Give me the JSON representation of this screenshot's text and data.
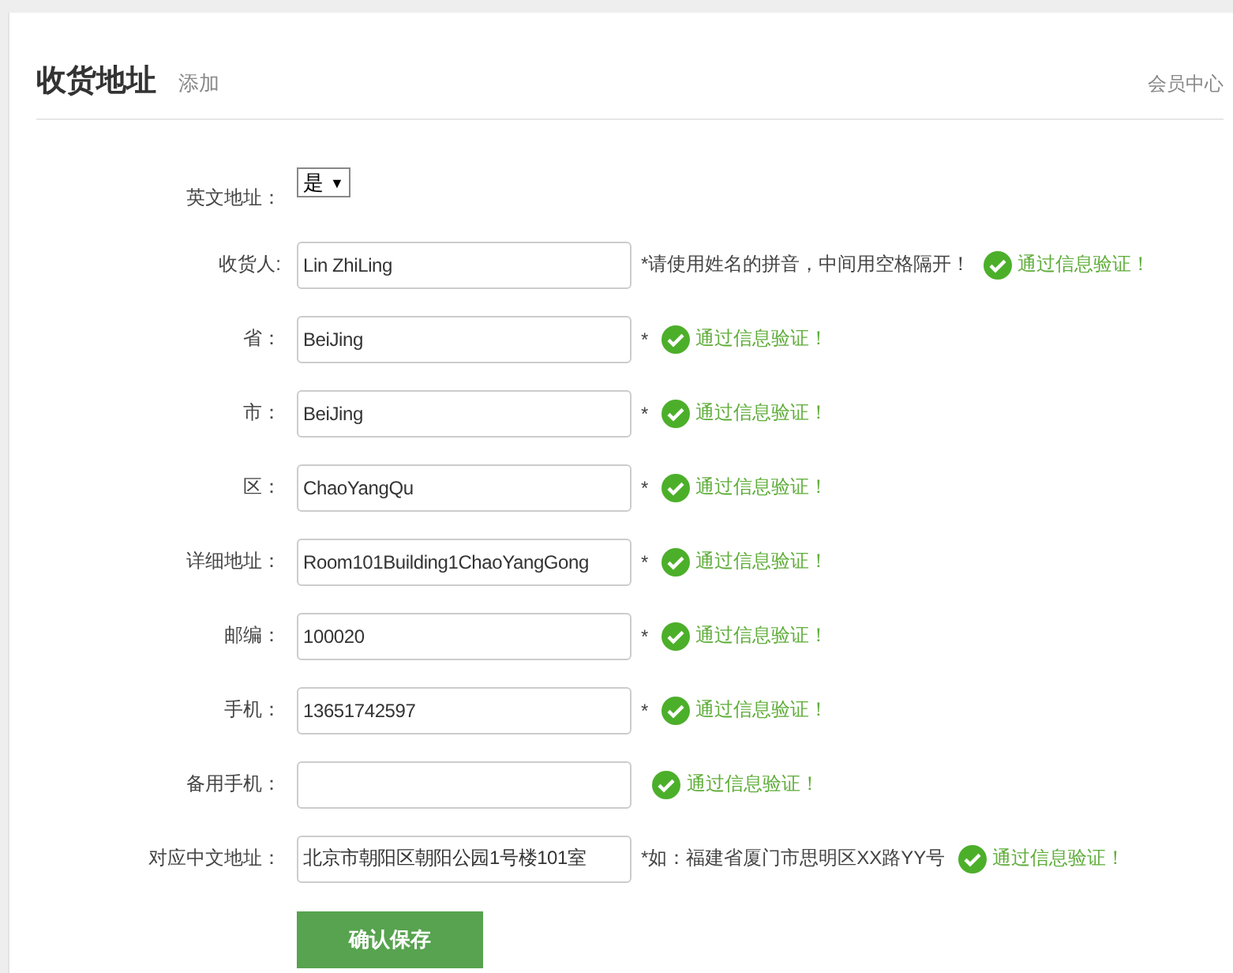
{
  "header": {
    "title": "收货地址",
    "subtitle": "添加",
    "link": "会员中心"
  },
  "fields": [
    {
      "kind": "select",
      "label": "英文地址：",
      "value": "是",
      "caret": "▼"
    },
    {
      "kind": "text",
      "label": "收货人:",
      "value": "Lin ZhiLing",
      "note": "*请使用姓名的拼音，中间用空格隔开！",
      "validation": {
        "text": "通过信息验证！",
        "passed": true
      }
    },
    {
      "kind": "text",
      "label": "省：",
      "value": "BeiJing",
      "note": "*",
      "validation": {
        "text": "通过信息验证！",
        "passed": true
      }
    },
    {
      "kind": "text",
      "label": "市：",
      "value": "BeiJing",
      "note": "*",
      "validation": {
        "text": "通过信息验证！",
        "passed": true
      }
    },
    {
      "kind": "text",
      "label": "区：",
      "value": "ChaoYangQu",
      "note": "*",
      "validation": {
        "text": "通过信息验证！",
        "passed": true
      }
    },
    {
      "kind": "text",
      "label": "详细地址：",
      "value": "Room101Building1ChaoYangGong",
      "note": "*",
      "validation": {
        "text": "通过信息验证！",
        "passed": true
      }
    },
    {
      "kind": "text",
      "label": "邮编：",
      "value": "100020",
      "note": "*",
      "validation": {
        "text": "通过信息验证！",
        "passed": true
      }
    },
    {
      "kind": "text",
      "label": "手机：",
      "value": "13651742597",
      "note": "*",
      "validation": {
        "text": "通过信息验证！",
        "passed": true
      }
    },
    {
      "kind": "text",
      "label": "备用手机：",
      "validation": {
        "text": "通过信息验证！",
        "passed": true
      }
    },
    {
      "kind": "text",
      "label": "对应中文地址：",
      "value": "北京市朝阳区朝阳公园1号楼101室",
      "note": "*如：福建省厦门市思明区XX路YY号",
      "validation": {
        "text": "通过信息验证！",
        "passed": true
      }
    }
  ],
  "submit": {
    "label": "确认保存"
  }
}
